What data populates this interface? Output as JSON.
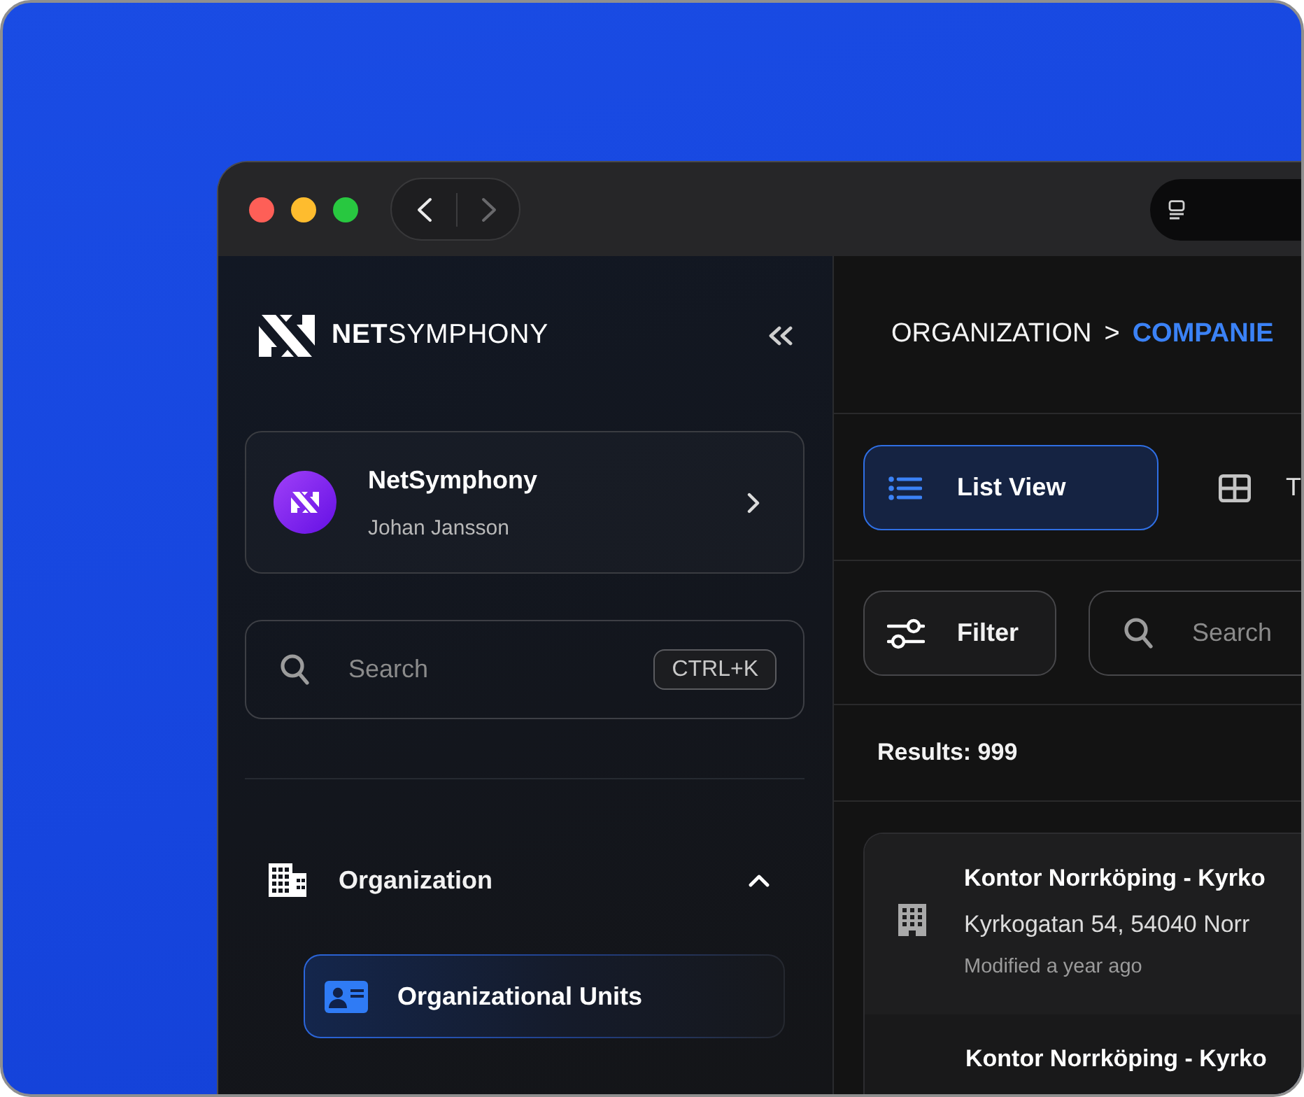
{
  "window": {
    "controls": [
      {
        "color": "#fe5f57"
      },
      {
        "color": "#febc2e"
      },
      {
        "color": "#28c840"
      }
    ],
    "history": [
      {
        "kind": "back",
        "disabled": false
      },
      {
        "kind": "forward",
        "disabled": true
      }
    ]
  },
  "sidebar": {
    "logo": "**NET**SYMPHONY",
    "workspace": {
      "name": "NetSymphony",
      "user": "Johan Jansson"
    },
    "search": {
      "placeholder": "Search",
      "shortcut": "CTRL+K"
    },
    "nav": [
      {
        "label": "Organization",
        "expanded": true,
        "children": [
          {
            "label": "Organizational Units",
            "selected": true
          }
        ]
      }
    ]
  },
  "main": {
    "breadcrumb": {
      "separator": ">",
      "items": [
        {
          "label": "ORGANIZATION",
          "current": false
        },
        {
          "label": "COMPANIE",
          "current": true
        }
      ]
    },
    "views": [
      {
        "kind": "list",
        "label": "List View",
        "selected": true
      },
      {
        "kind": "table",
        "label": "T",
        "selected": false
      }
    ],
    "filter": {
      "label": "Filter"
    },
    "search": {
      "placeholder": "Search"
    },
    "results": "Results: 999",
    "companies": [
      {
        "name": "Kontor Norrköping - Kyrko",
        "address": "Kyrkogatan 54, 54040 Norr",
        "modified": "Modified a year ago"
      },
      {
        "name": "Kontor Norrköping - Kyrko"
      }
    ]
  }
}
